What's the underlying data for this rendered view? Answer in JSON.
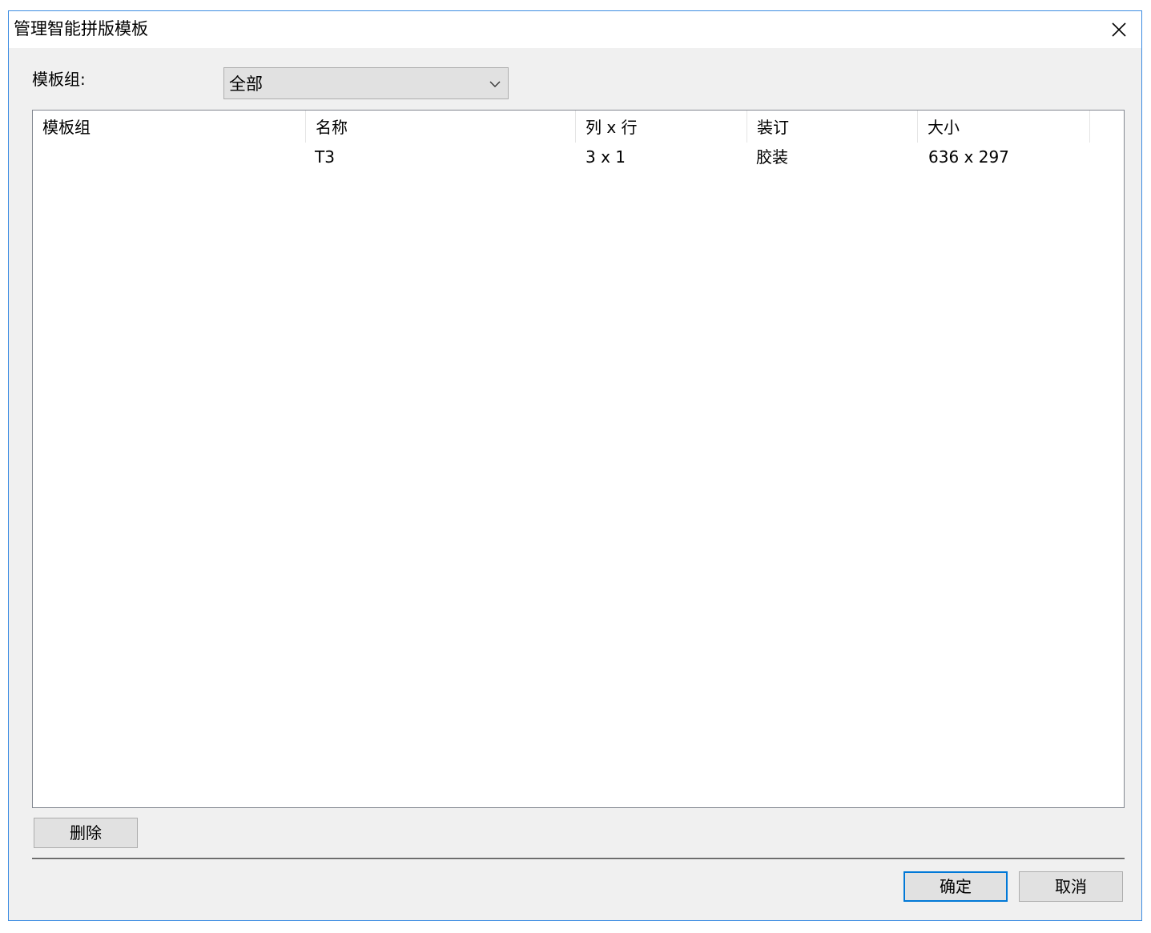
{
  "window": {
    "title": "管理智能拼版模板"
  },
  "filter": {
    "label": "模板组:",
    "selected": "全部"
  },
  "table": {
    "columns": [
      "模板组",
      "名称",
      "列 x 行",
      "装订",
      "大小"
    ],
    "rows": [
      {
        "group": "",
        "name": "T3",
        "grid": "3 x 1",
        "binding": "胶装",
        "size": "636 x 297"
      }
    ]
  },
  "buttons": {
    "delete": "删除",
    "ok": "确定",
    "cancel": "取消"
  }
}
